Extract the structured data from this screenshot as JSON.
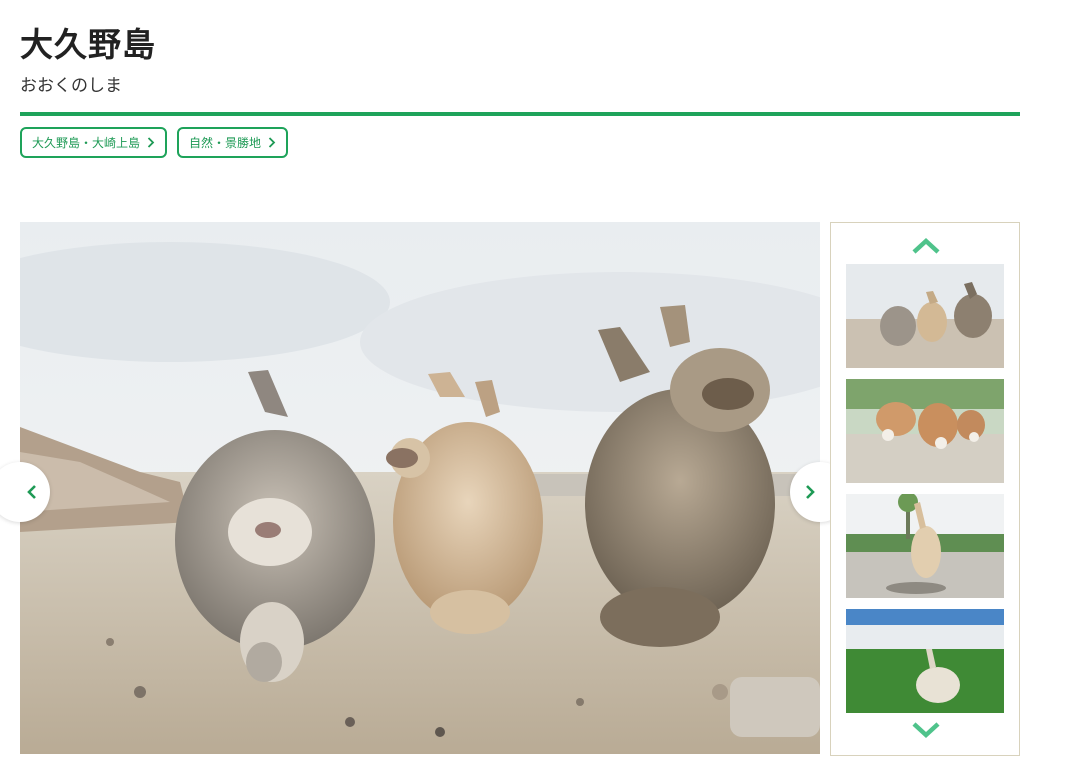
{
  "page": {
    "title": "大久野島",
    "reading": "おおくのしま"
  },
  "tags": [
    {
      "label": "大久野島・大崎上島"
    },
    {
      "label": "自然・景勝地"
    }
  ],
  "gallery": {
    "main_image": "rabbits-closeup-photo",
    "thumbnails": [
      "three-rabbits-photo",
      "rabbits-from-behind-photo",
      "rabbit-standing-palm-trees-photo",
      "rabbit-on-lawn-hotel-photo"
    ]
  },
  "icons": {
    "prev": "chevron-left-icon",
    "next": "chevron-right-icon",
    "thumb_up": "chevron-up-icon",
    "thumb_down": "chevron-down-icon",
    "tag": "chevron-right-icon"
  },
  "colors": {
    "accent": "#1ea35a",
    "thumb_arrow": "#4fc38b"
  }
}
